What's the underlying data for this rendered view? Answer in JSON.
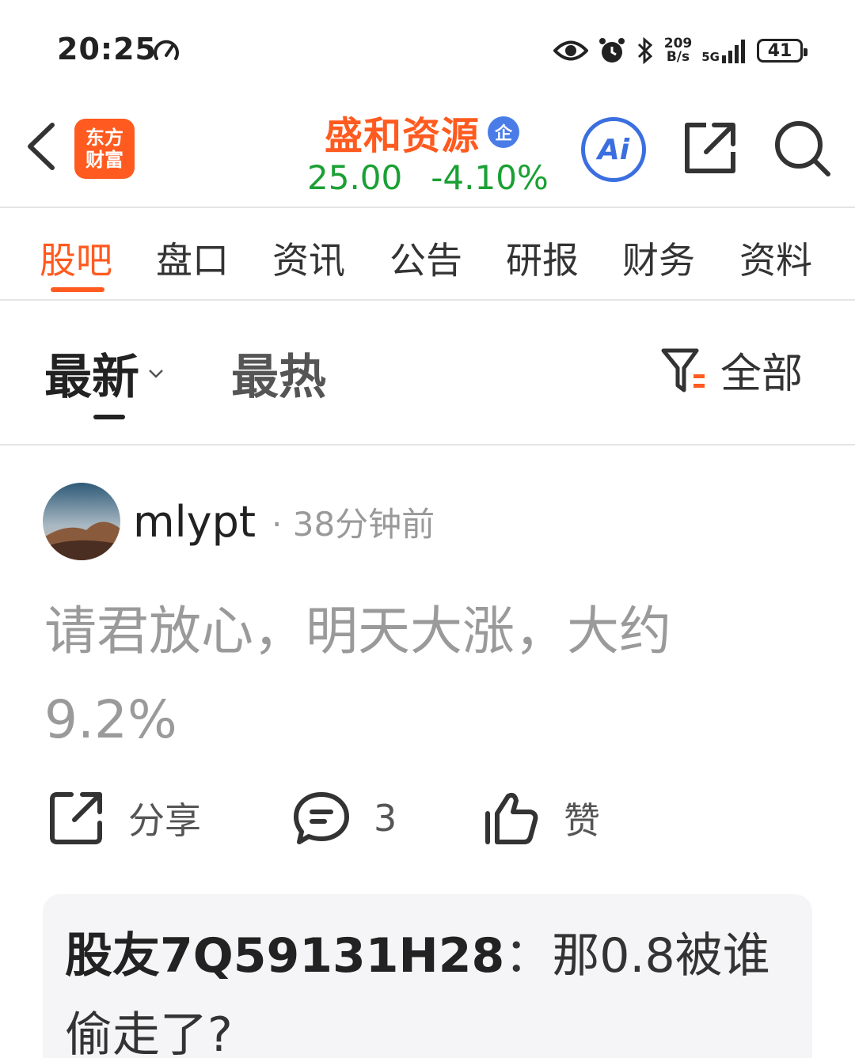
{
  "status_bar": {
    "time": "20:25",
    "net_speed_value": "209",
    "net_speed_unit": "B/s",
    "network": "5G",
    "battery": "41"
  },
  "header": {
    "logo_line1": "东方",
    "logo_line2": "财富",
    "stock_name": "盛和资源",
    "badge": "企",
    "price": "25.00",
    "change": "-4.10%",
    "ai_label": "Ai",
    "accent_color": "#ff5a1f",
    "price_color": "#1aa034"
  },
  "tabs": [
    {
      "label": "股吧",
      "active": true
    },
    {
      "label": "盘口"
    },
    {
      "label": "资讯"
    },
    {
      "label": "公告"
    },
    {
      "label": "研报"
    },
    {
      "label": "财务"
    },
    {
      "label": "资料"
    }
  ],
  "sortbar": {
    "latest": "最新",
    "hot": "最热",
    "filter": "全部"
  },
  "post": {
    "username": "mlypt",
    "time": "· 38分钟前",
    "content": "请君放心，明天大涨，大约9.2%",
    "share_label": "分享",
    "comment_count": "3",
    "like_label": "赞",
    "reply": {
      "user": "股友7Q59131H28",
      "separator": "：",
      "text": "那0.8被谁偷走了?"
    }
  }
}
